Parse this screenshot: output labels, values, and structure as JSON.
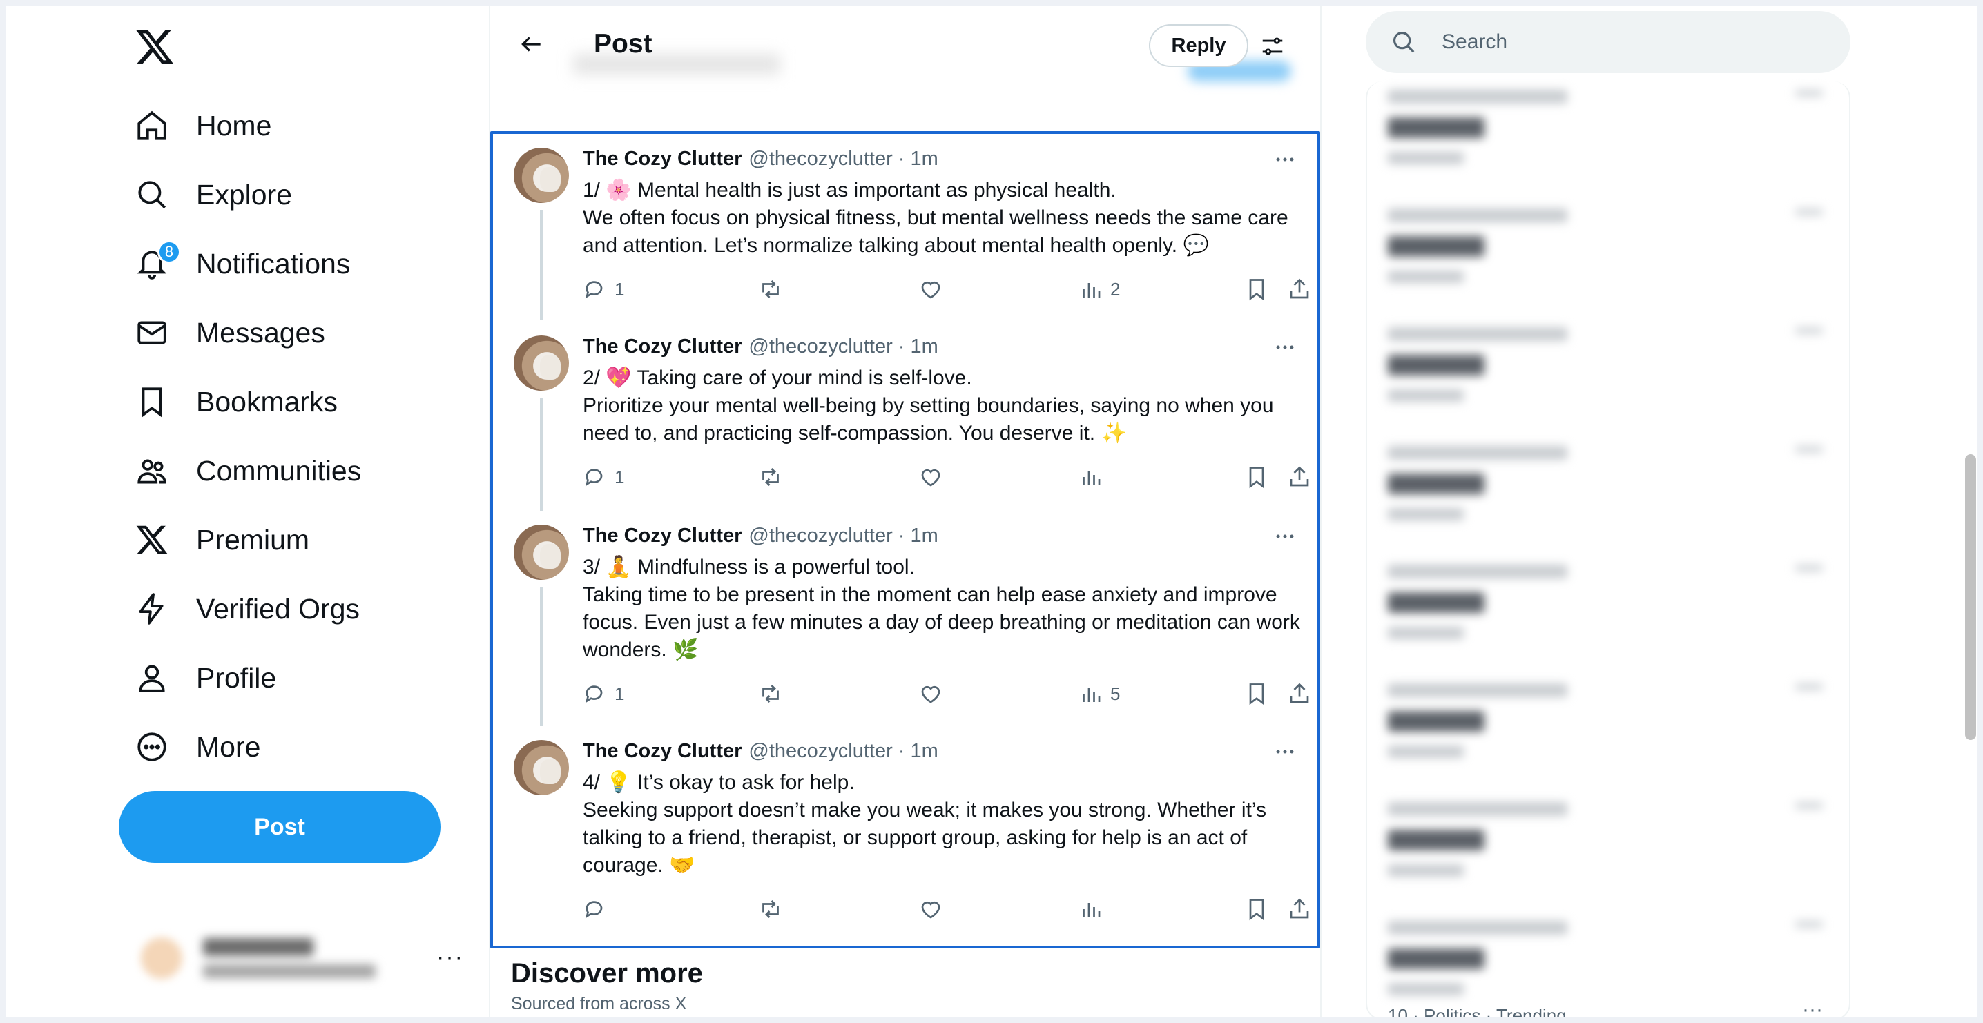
{
  "nav": {
    "items": [
      {
        "label": "Home",
        "icon": "home-icon"
      },
      {
        "label": "Explore",
        "icon": "search-icon"
      },
      {
        "label": "Notifications",
        "icon": "bell-icon",
        "badge": "8"
      },
      {
        "label": "Messages",
        "icon": "envelope-icon"
      },
      {
        "label": "Bookmarks",
        "icon": "bookmark-icon"
      },
      {
        "label": "Communities",
        "icon": "people-icon"
      },
      {
        "label": "Premium",
        "icon": "x-logo-icon"
      },
      {
        "label": "Verified Orgs",
        "icon": "lightning-icon"
      },
      {
        "label": "Profile",
        "icon": "person-icon"
      },
      {
        "label": "More",
        "icon": "more-circle-icon"
      }
    ],
    "post_button": "Post",
    "account_more": "···"
  },
  "header": {
    "title": "Post",
    "reply_button": "Reply"
  },
  "thread": [
    {
      "name": "The Cozy Clutter",
      "handle": "@thecozyclutter",
      "sep": "·",
      "time": "1m",
      "line1": "1/ 🌸 Mental health is just as important as physical health.",
      "line2": "We often focus on physical fitness, but mental wellness needs the same care and attention. Let’s normalize talking about mental health openly. 💬",
      "replies": "1",
      "reposts": "",
      "likes": "",
      "views": "2"
    },
    {
      "name": "The Cozy Clutter",
      "handle": "@thecozyclutter",
      "sep": "·",
      "time": "1m",
      "line1": "2/ 💖 Taking care of your mind is self-love.",
      "line2": "Prioritize your mental well-being by setting boundaries, saying no when you need to, and practicing self-compassion. You deserve it. ✨",
      "replies": "1",
      "reposts": "",
      "likes": "",
      "views": ""
    },
    {
      "name": "The Cozy Clutter",
      "handle": "@thecozyclutter",
      "sep": "·",
      "time": "1m",
      "line1": "3/ 🧘 Mindfulness is a powerful tool.",
      "line2": "Taking time to be present in the moment can help ease anxiety and improve focus. Even just a few minutes a day of deep breathing or meditation can work wonders. 🌿",
      "replies": "1",
      "reposts": "",
      "likes": "",
      "views": "5"
    },
    {
      "name": "The Cozy Clutter",
      "handle": "@thecozyclutter",
      "sep": "·",
      "time": "1m",
      "line1": "4/ 💡 It’s okay to ask for help.",
      "line2": "Seeking support doesn’t make you weak; it makes you strong. Whether it’s talking to a friend, therapist, or support group, asking for help is an act of courage. 🤝",
      "replies": "",
      "reposts": "",
      "likes": "",
      "views": ""
    }
  ],
  "discover": {
    "title": "Discover more",
    "subtitle": "Sourced from across X"
  },
  "search": {
    "placeholder": "Search"
  },
  "trends": {
    "last_visible": "10 · Politics · Trending",
    "more": "···"
  },
  "colors": {
    "accent": "#1d9bf0",
    "focus_border": "#1967d2",
    "muted_text": "#536471"
  }
}
